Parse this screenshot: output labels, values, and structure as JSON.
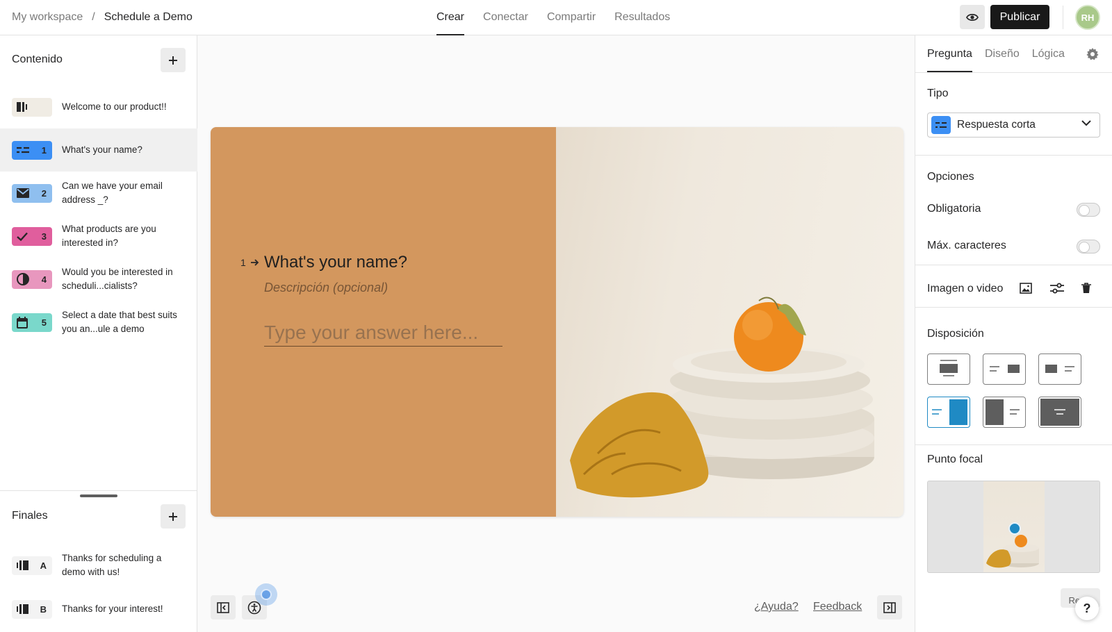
{
  "breadcrumb": {
    "workspace": "My workspace",
    "separator": "/",
    "form": "Schedule a Demo"
  },
  "nav_tabs": [
    {
      "label": "Crear",
      "active": true
    },
    {
      "label": "Conectar",
      "active": false
    },
    {
      "label": "Compartir",
      "active": false
    },
    {
      "label": "Resultados",
      "active": false
    }
  ],
  "header": {
    "publish_label": "Publicar",
    "avatar_initials": "RH"
  },
  "content_panel": {
    "title": "Contenido",
    "add_icon": "plus-icon",
    "items": [
      {
        "number": "",
        "label": "Welcome to our product!!",
        "icon": "welcome-screen-icon",
        "color": "#f0ece4"
      },
      {
        "number": "1",
        "label": "What's your name?",
        "icon": "short-text-icon",
        "color": "#3c8ff4",
        "selected": true
      },
      {
        "number": "2",
        "label": "Can we have your email address _?",
        "icon": "email-icon",
        "color": "#8fbfef"
      },
      {
        "number": "3",
        "label": "What products are you interested in?",
        "icon": "checkmark-icon",
        "color": "#e05e9d"
      },
      {
        "number": "4",
        "label": "Would you be interested in scheduli...cialists?",
        "icon": "yes-no-icon",
        "color": "#e897be"
      },
      {
        "number": "5",
        "label": "Select a date that best suits you an...ule a demo",
        "icon": "calendar-icon",
        "color": "#7ad8cb"
      }
    ]
  },
  "endings_panel": {
    "title": "Finales",
    "items": [
      {
        "letter": "A",
        "label": "Thanks for scheduling a demo with us!",
        "icon": "ending-screen-icon"
      },
      {
        "letter": "B",
        "label": "Thanks for your interest!",
        "icon": "ending-screen-icon"
      }
    ]
  },
  "question_card": {
    "index": "1",
    "title": "What's your name?",
    "description_placeholder": "Descripción (opcional)",
    "answer_placeholder": "Type your answer here...",
    "left_color": "#d3975e"
  },
  "footer": {
    "help_link": "¿Ayuda?",
    "feedback_link": "Feedback"
  },
  "settings_panel": {
    "tabs": [
      {
        "label": "Pregunta",
        "active": true
      },
      {
        "label": "Diseño",
        "active": false
      },
      {
        "label": "Lógica",
        "active": false
      }
    ],
    "type_label": "Tipo",
    "type_value": "Respuesta corta",
    "options_label": "Opciones",
    "required_label": "Obligatoria",
    "required_on": false,
    "max_chars_label": "Máx. caracteres",
    "max_chars_on": false,
    "media_label": "Imagen o video",
    "layout_label": "Disposición",
    "focal_label": "Punto focal",
    "reset_label": "Reset",
    "help_fab": "?",
    "accent_color": "#1f8ac4"
  }
}
